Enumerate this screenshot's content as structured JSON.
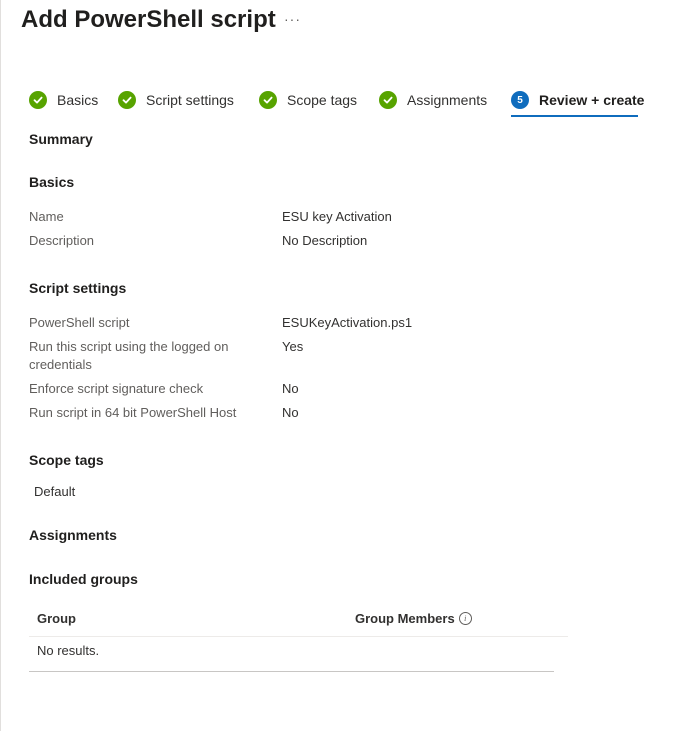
{
  "page": {
    "title": "Add PowerShell script",
    "more": "···"
  },
  "steps": [
    {
      "label": "Basics",
      "state": "complete"
    },
    {
      "label": "Script settings",
      "state": "complete"
    },
    {
      "label": "Scope tags",
      "state": "complete"
    },
    {
      "label": "Assignments",
      "state": "complete"
    },
    {
      "label": "Review + create",
      "state": "current",
      "number": "5"
    }
  ],
  "summary": {
    "heading": "Summary"
  },
  "basics": {
    "heading": "Basics",
    "rows": [
      {
        "label": "Name",
        "value": "ESU key Activation"
      },
      {
        "label": "Description",
        "value": "No Description"
      }
    ]
  },
  "script_settings": {
    "heading": "Script settings",
    "rows": [
      {
        "label": "PowerShell script",
        "value": "ESUKeyActivation.ps1"
      },
      {
        "label": "Run this script using the logged on credentials",
        "value": "Yes"
      },
      {
        "label": "Enforce script signature check",
        "value": "No"
      },
      {
        "label": "Run script in 64 bit PowerShell Host",
        "value": "No"
      }
    ]
  },
  "scope_tags": {
    "heading": "Scope tags",
    "items": [
      "Default"
    ]
  },
  "assignments": {
    "heading": "Assignments",
    "included_groups": {
      "heading": "Included groups",
      "columns": [
        "Group",
        "Group Members"
      ],
      "empty_text": "No results."
    }
  },
  "colors": {
    "complete": "#57a300",
    "accent": "#0f6cbd"
  },
  "icons": {
    "complete": "checkmark-circle-icon",
    "info": "info-icon"
  }
}
